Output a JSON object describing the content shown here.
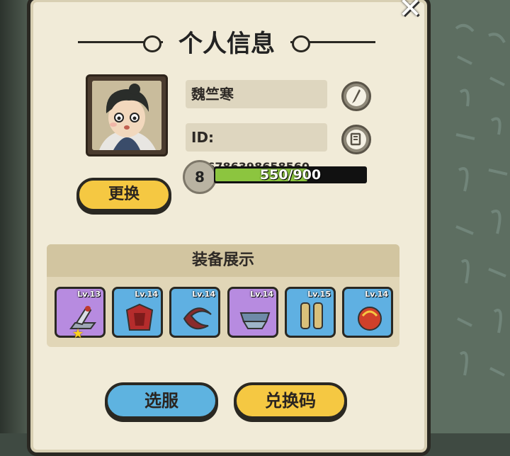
{
  "window": {
    "title": "个人信息"
  },
  "profile": {
    "name": "魏竺寒",
    "id_label": "ID:",
    "id_value": "366786398658560",
    "level": "8",
    "xp_text": "550/900",
    "xp_progress": 0.611
  },
  "buttons": {
    "change_avatar": "更换",
    "select_server": "选服",
    "redeem_code": "兑换码"
  },
  "equipment": {
    "title": "装备展示",
    "items": [
      {
        "level": "Lv.13",
        "rarity": "purple",
        "icon": "sword-fragment-icon"
      },
      {
        "level": "Lv.14",
        "rarity": "blue",
        "icon": "red-armor-icon"
      },
      {
        "level": "Lv.14",
        "rarity": "blue",
        "icon": "red-ring-icon"
      },
      {
        "level": "Lv.14",
        "rarity": "purple",
        "icon": "shoulder-guard-icon"
      },
      {
        "level": "Lv.15",
        "rarity": "blue",
        "icon": "leg-armor-icon"
      },
      {
        "level": "Lv.14",
        "rarity": "blue",
        "icon": "orb-icon"
      }
    ]
  },
  "colors": {
    "panel_bg": "#f1ebd8",
    "yellow_button": "#f5c842",
    "blue_button": "#5eb3e0",
    "xp_fill": "#8cc53f",
    "rarity_purple": "#b78be0",
    "rarity_blue": "#5fb0e2"
  }
}
